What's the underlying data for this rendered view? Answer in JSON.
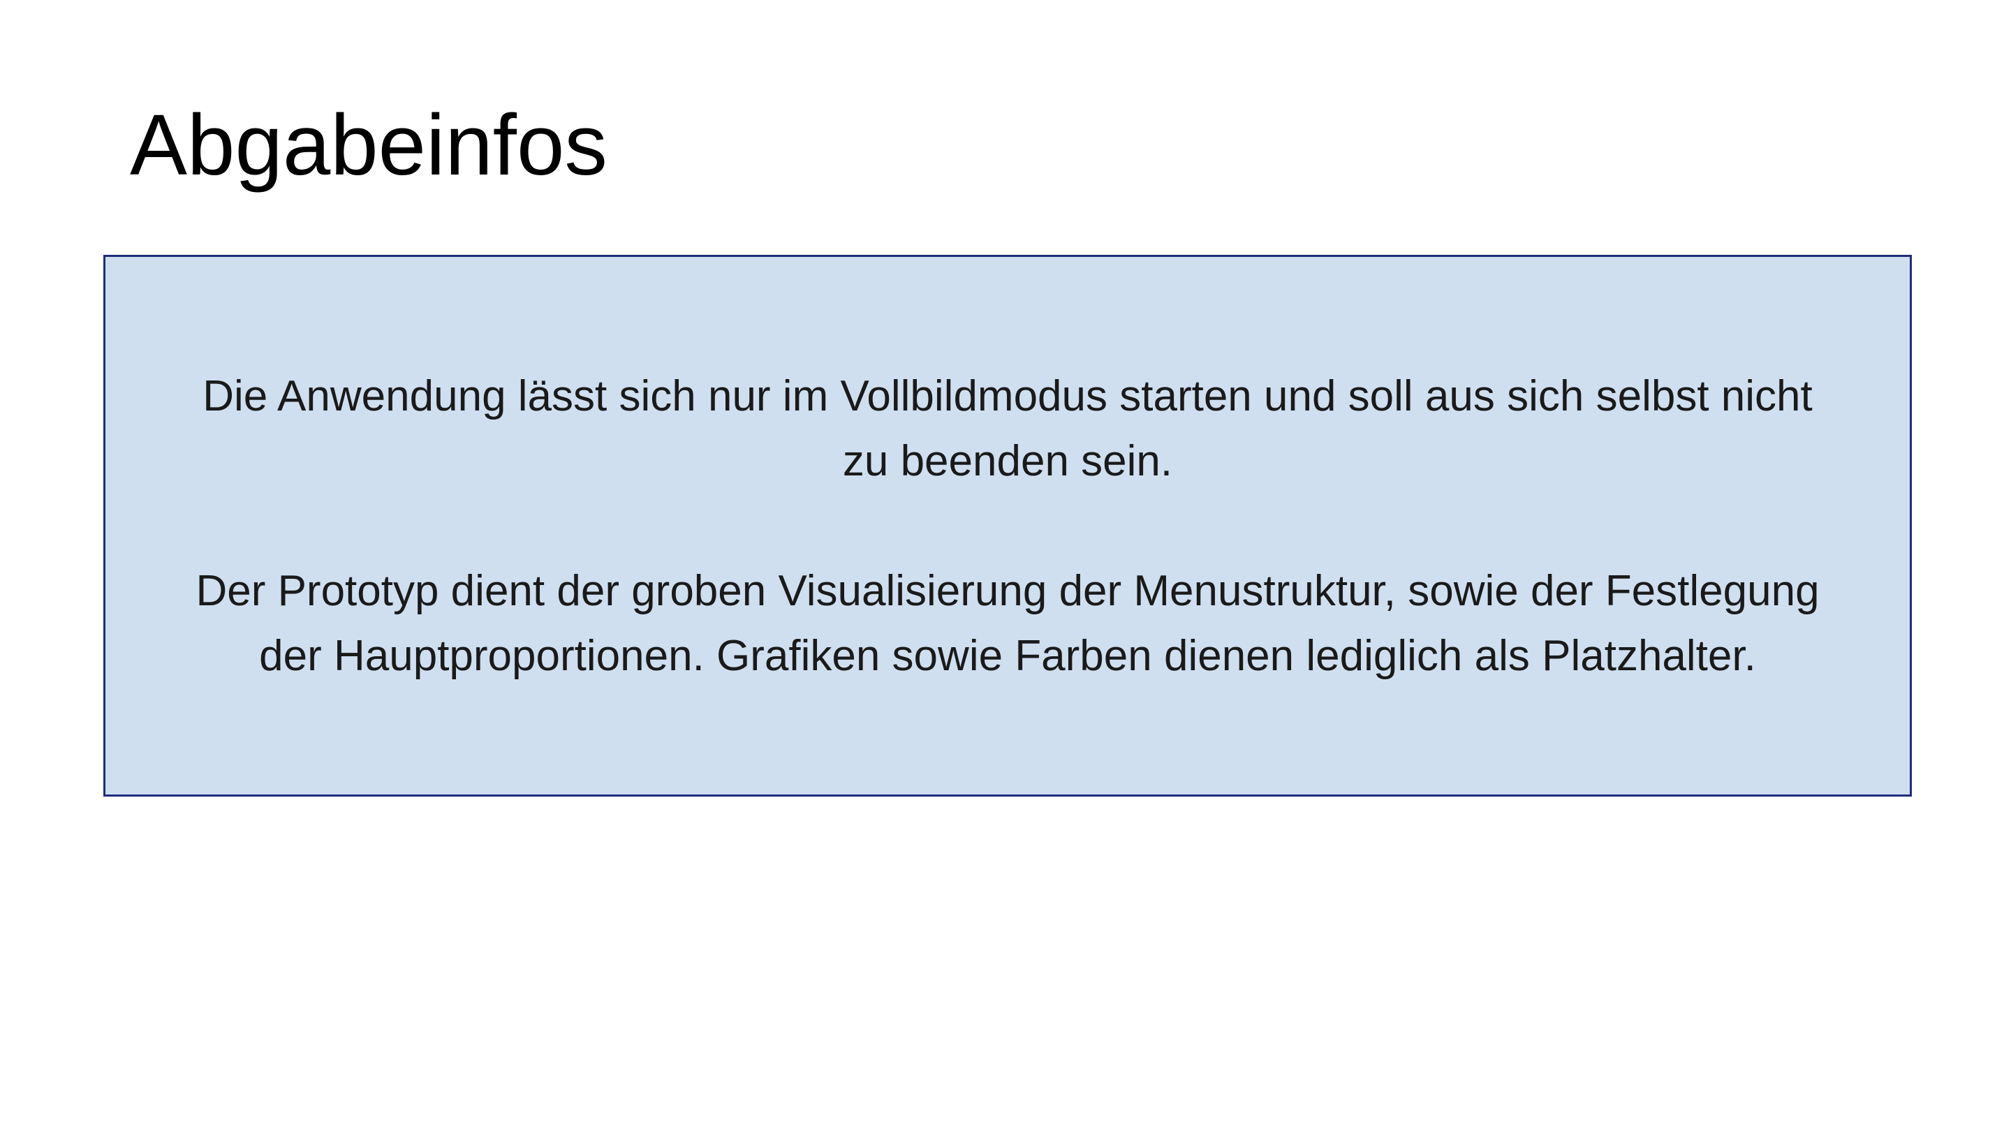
{
  "slide": {
    "title": "Abgabeinfos",
    "paragraphs": [
      "Die Anwendung lässt sich nur im Vollbildmodus starten und soll aus sich selbst nicht zu beenden sein.",
      "Der Prototyp dient der groben Visualisierung der Menustruktur, sowie der Festlegung der Hauptproportionen. Grafiken sowie Farben dienen lediglich als Platzhalter."
    ],
    "colors": {
      "box_fill": "#cfdff0",
      "box_border": "#1f2d7a",
      "text": "#1a1a1a"
    }
  }
}
